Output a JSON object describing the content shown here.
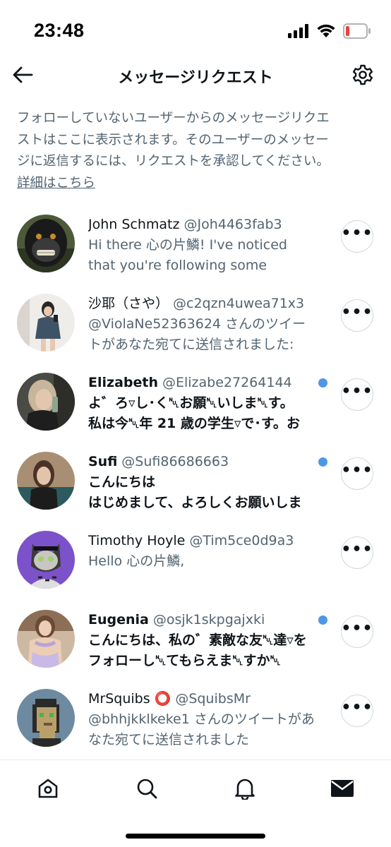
{
  "status_bar": {
    "time": "23:48"
  },
  "header": {
    "title": "メッセージリクエスト"
  },
  "description": {
    "line1": "フォローしていないユーザーからのメッセージリクエ",
    "line2": "ストはここに表示されます。そのユーザーのメッセー",
    "line3": "ジに返信するには、リクエストを承認してください。",
    "link": "詳細はこちら"
  },
  "requests": [
    {
      "name": "John Schmatz",
      "handle": "@Joh4463fab3",
      "line1": "Hi there 心の片鱗! I've noticed",
      "line2": "that you're following some",
      "unread": false
    },
    {
      "name": "沙耶（さや）",
      "handle": "@c2qzn4uwea71x3",
      "line1": "@ViolaNe52363624 さんのツイー",
      "line2": "トがあなた宛てに送信されました:",
      "unread": false
    },
    {
      "name": "Elizabeth",
      "handle": "@Elizabe27264144",
      "line1": "よ゛ろ▿し･く␀お願␀いしま␀す。",
      "line2": "私は今␀年 21 歳の学生▿で･す。お",
      "unread": true
    },
    {
      "name": "Sufi",
      "handle": "@Sufi86686663",
      "line1": "こんにちは",
      "line2": "はじめまして、よろしくお願いしま",
      "unread": true
    },
    {
      "name": "Timothy Hoyle",
      "handle": "@Tim5ce0d9a3",
      "line1": "Hello 心の片鱗,",
      "line2": "",
      "unread": false
    },
    {
      "name": "Eugenia",
      "handle": "@osjk1skpgajxki",
      "line1": "こんにちは、私の゛素敵な友␀達▿を",
      "line2": "フォローし␀てもらえま␀すか␀",
      "unread": true
    },
    {
      "name": "MrSquibs ⭕",
      "handle": "@SquibsMr",
      "line1": "@bhhjkklkeke1 さんのツイートがあ",
      "line2": "なた宛てに送信されました",
      "unread": false
    }
  ],
  "more_label": "•••",
  "colors": {
    "accent": "#4e97e8",
    "text": "#0f1419",
    "secondary": "#536471"
  },
  "nav": {
    "items": [
      "home-icon",
      "search-icon",
      "bell-icon",
      "mail-icon"
    ],
    "active": "mail-icon"
  }
}
